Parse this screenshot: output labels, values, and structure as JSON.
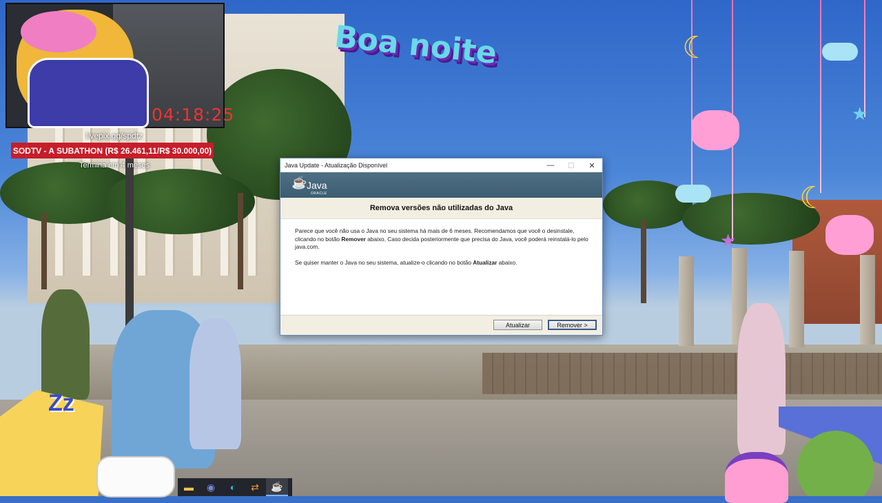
{
  "overlay": {
    "timer": "04:18:25",
    "livepix": "livepix.gg/spdtz",
    "subathon_bar": "SODTV - A SUBATHON (R$ 26.461,11/R$ 30.000,00)",
    "subathon_sub": "Termina em 4 meses",
    "goodnight": "Boa noite"
  },
  "dialog": {
    "title": "Java Update - Atualização Disponível",
    "logo_text": "Java",
    "logo_sub": "ORACLE",
    "heading": "Remova versões não utilizadas do Java",
    "p1_a": "Parece que você não usa o Java no seu sistema há mais de 6 meses. Recomendamos que você o desinstale, clicando no botão ",
    "p1_bold": "Remover",
    "p1_b": " abaixo. Caso decida posteriormente que precisa do Java, você poderá reinstalá-lo pelo java.com.",
    "p2_a": "Se quiser manter o Java no seu sistema, atualize-o clicando no botão ",
    "p2_bold": "Atualizar",
    "p2_b": " abaixo.",
    "update_button": "Atualizar",
    "remove_button": "Remover >",
    "minimize": "—",
    "maximize": "☐",
    "close": "✕"
  },
  "taskbar": {
    "apps": [
      {
        "name": "file-explorer",
        "icon": "▬",
        "color": "#f2c14e"
      },
      {
        "name": "discord",
        "icon": "◉",
        "color": "#7289da"
      },
      {
        "name": "edge",
        "icon": "◐",
        "color": "#2fb5c9"
      },
      {
        "name": "app-arrows",
        "icon": "⇄",
        "color": "#f39c34"
      },
      {
        "name": "java-update",
        "icon": "☕",
        "color": "#e0e0e0"
      }
    ]
  }
}
